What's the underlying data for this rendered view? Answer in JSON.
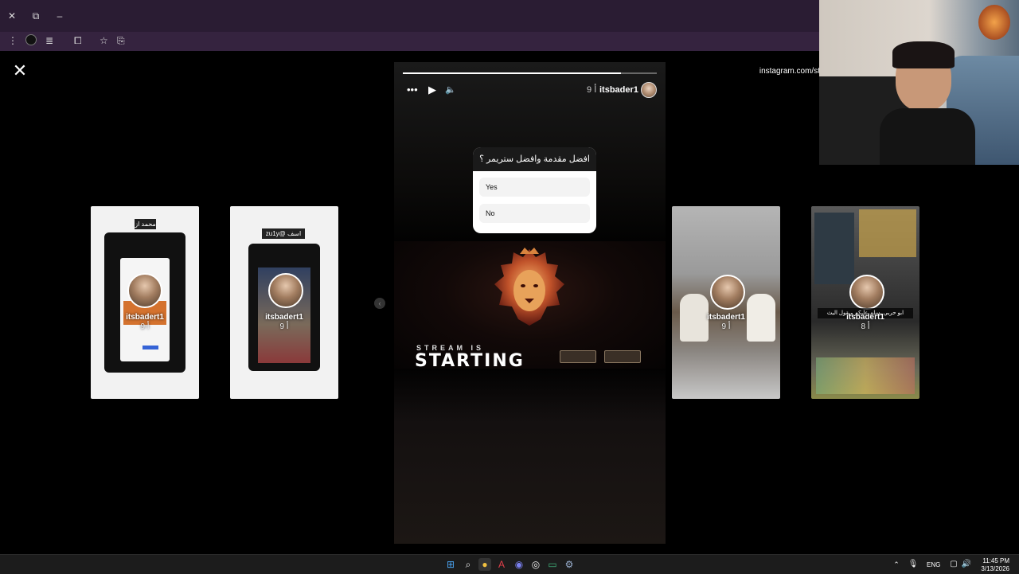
{
  "browser": {
    "url": "instagram.com/st"
  },
  "story": {
    "username": "itsbader1",
    "time": "9 أ",
    "poll": {
      "question": "افضل مقدمة وافضل ستريمر ؟",
      "options": [
        "Yes",
        "No"
      ]
    },
    "banner": {
      "line1": "STREAM IS",
      "line2": "STARTING"
    },
    "progress": 0.86
  },
  "thumbnails": [
    {
      "username": "itsbadert1",
      "time": "9 أ",
      "tag": "محمد از"
    },
    {
      "username": "itsbadert1",
      "time": "9 أ",
      "tag": "zu1y@ اسف"
    },
    {
      "username": "itsbadert1",
      "time": "9 أ",
      "tag": ""
    },
    {
      "username": "itsbadert1",
      "time": "8 أ",
      "tag": "ابو حربي يسلم عليكم ويقول البث"
    }
  ],
  "taskbar": {
    "language": "ENG",
    "time": "11:45 PM",
    "date": "3/13/2026"
  },
  "colors": {
    "chrome_title": "#2a1c33",
    "chrome_toolbar": "#35233f",
    "background": "#000000"
  },
  "icons": {
    "close": "close-icon",
    "more": "more-options-icon",
    "play": "play-icon",
    "sound": "speaker-icon"
  }
}
